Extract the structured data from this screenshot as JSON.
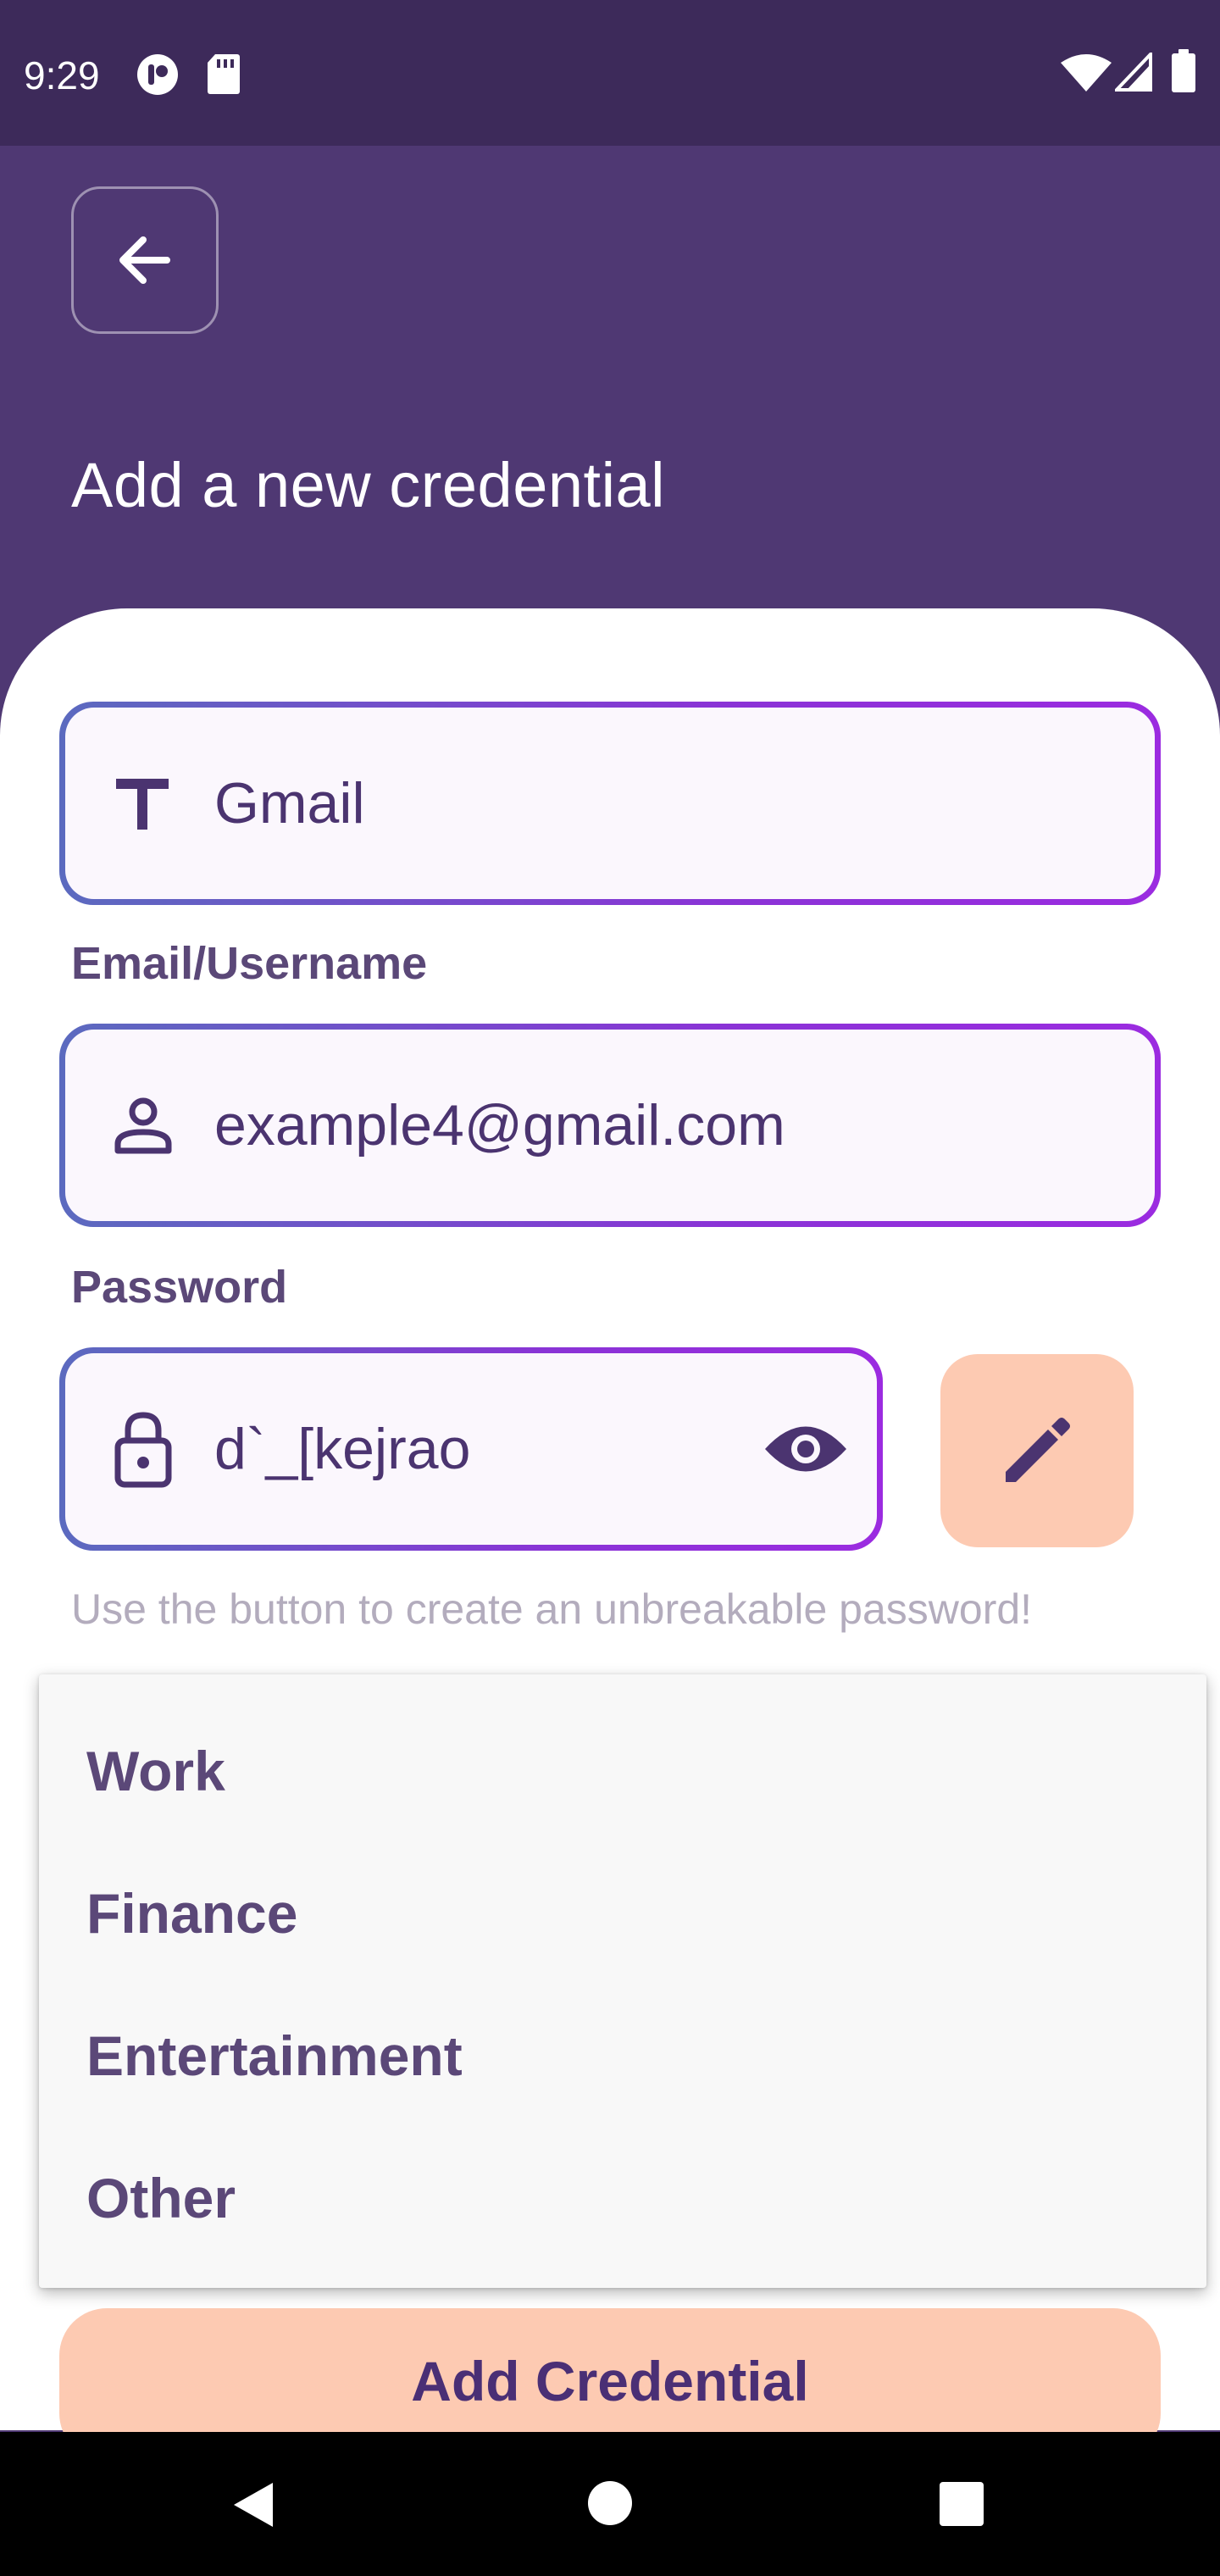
{
  "status_bar": {
    "time": "9:29",
    "left_icons": [
      "privacy-indicator-icon",
      "sd-card-icon"
    ],
    "right_icons": [
      "wifi-icon",
      "signal-icon",
      "battery-icon"
    ]
  },
  "header": {
    "back_icon": "arrow-left-icon",
    "title": "Add a new credential"
  },
  "form": {
    "title_field": {
      "icon": "text-t-icon",
      "value": "Gmail"
    },
    "email_label": "Email/Username",
    "email_field": {
      "icon": "person-icon",
      "value": "example4@gmail.com"
    },
    "password_label": "Password",
    "password_field": {
      "icon": "lock-icon",
      "value": "d`_[kejrao",
      "visibility_icon": "eye-icon"
    },
    "generate_button_icon": "pencil-icon",
    "hint": "Use the button to create an unbreakable password!"
  },
  "category_dropdown": {
    "options": [
      "Work",
      "Finance",
      "Entertainment",
      "Other"
    ]
  },
  "submit_button": {
    "label": "Add Credential"
  },
  "nav_bar": {
    "icons": [
      "back-triangle-icon",
      "home-circle-icon",
      "recents-square-icon"
    ]
  },
  "colors": {
    "header_bg": "#4f3873",
    "status_bg": "#3d2a5a",
    "accent_peach": "#fdcab2",
    "text_purple": "#4b3470",
    "gradient_start": "#5b6abf",
    "gradient_end": "#9b2be0"
  }
}
